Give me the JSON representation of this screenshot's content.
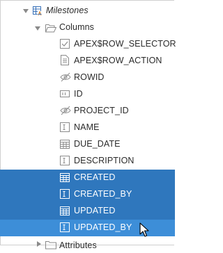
{
  "tree": {
    "region": {
      "label": "Milestones",
      "expanded": true
    },
    "columns_folder": {
      "label": "Columns",
      "expanded": true
    },
    "columns": [
      {
        "label": "APEX$ROW_SELECTOR",
        "icon": "row-selector-checkbox-icon",
        "selected": false
      },
      {
        "label": "APEX$ROW_ACTION",
        "icon": "row-action-document-icon",
        "selected": false
      },
      {
        "label": "ROWID",
        "icon": "hidden-eye-icon",
        "selected": false
      },
      {
        "label": "ID",
        "icon": "number-field-icon",
        "selected": false
      },
      {
        "label": "PROJECT_ID",
        "icon": "hidden-eye-icon",
        "selected": false
      },
      {
        "label": "NAME",
        "icon": "text-field-icon",
        "selected": false
      },
      {
        "label": "DUE_DATE",
        "icon": "date-picker-icon",
        "selected": false
      },
      {
        "label": "DESCRIPTION",
        "icon": "text-field-icon",
        "selected": false
      },
      {
        "label": "CREATED",
        "icon": "date-picker-icon",
        "selected": true
      },
      {
        "label": "CREATED_BY",
        "icon": "text-field-icon",
        "selected": true
      },
      {
        "label": "UPDATED",
        "icon": "date-picker-icon",
        "selected": true
      },
      {
        "label": "UPDATED_BY",
        "icon": "text-field-icon",
        "selected": true
      }
    ],
    "attributes_folder": {
      "label": "Attributes",
      "expanded": false
    }
  },
  "colors": {
    "selection": "#2f77bd",
    "selection_hover": "#3d8ed8",
    "icon_gray": "#8a8a8a",
    "region_icon_blue": "#3b73b9"
  }
}
